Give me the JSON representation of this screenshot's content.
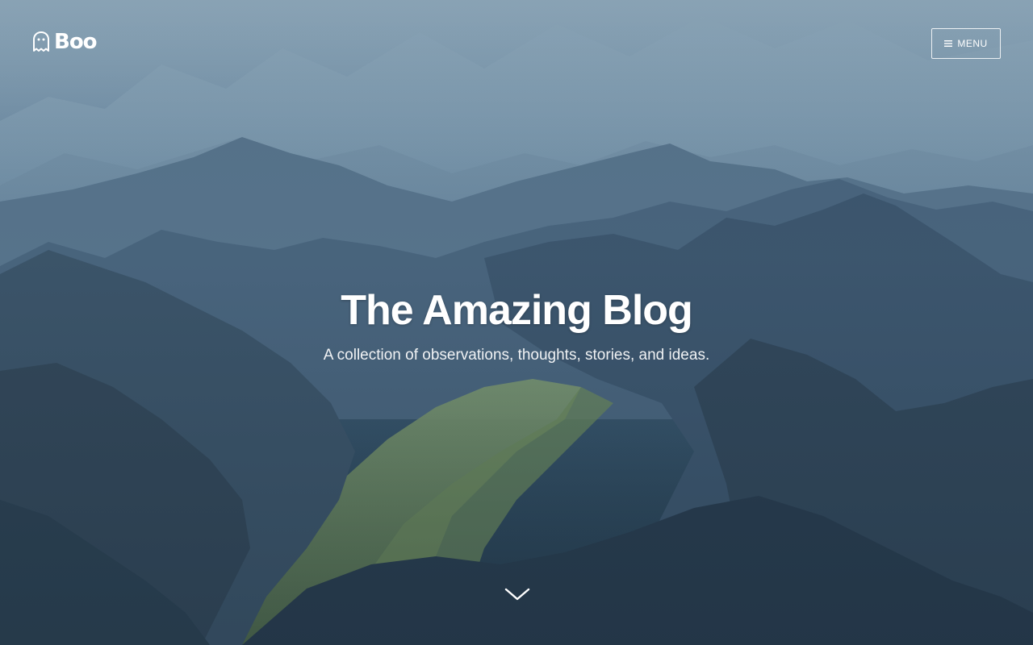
{
  "header": {
    "logo_text": "Boo",
    "logo_icon": "ghost-icon",
    "menu_label": "MENU",
    "menu_icon": "hamburger-icon"
  },
  "hero": {
    "title": "The Amazing Blog",
    "description": "A collection of observations, thoughts, stories, and ideas.",
    "scroll_icon": "chevron-down-icon"
  },
  "colors": {
    "text": "#ffffff",
    "sky": "#7f9db2",
    "mountains_far": "#6f8ea6",
    "mountains_mid": "#4a6780",
    "mountains_near": "#2c4254",
    "valley_green": "#6e8f62"
  }
}
